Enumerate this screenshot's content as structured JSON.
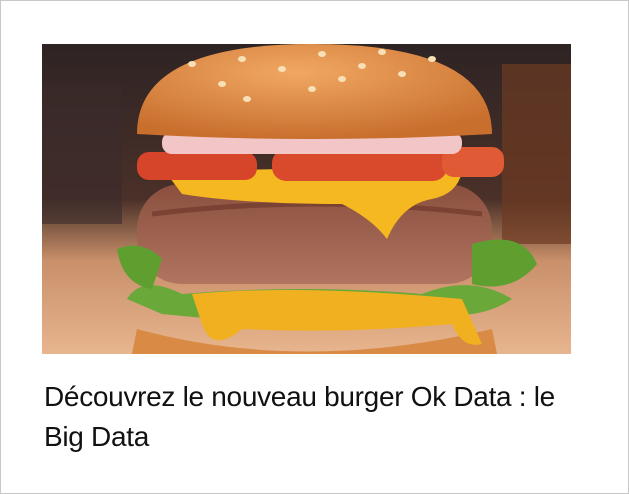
{
  "card": {
    "image": {
      "subject": "burger-image"
    },
    "title": "Découvrez le nouveau burger Ok Data : le Big Data"
  }
}
